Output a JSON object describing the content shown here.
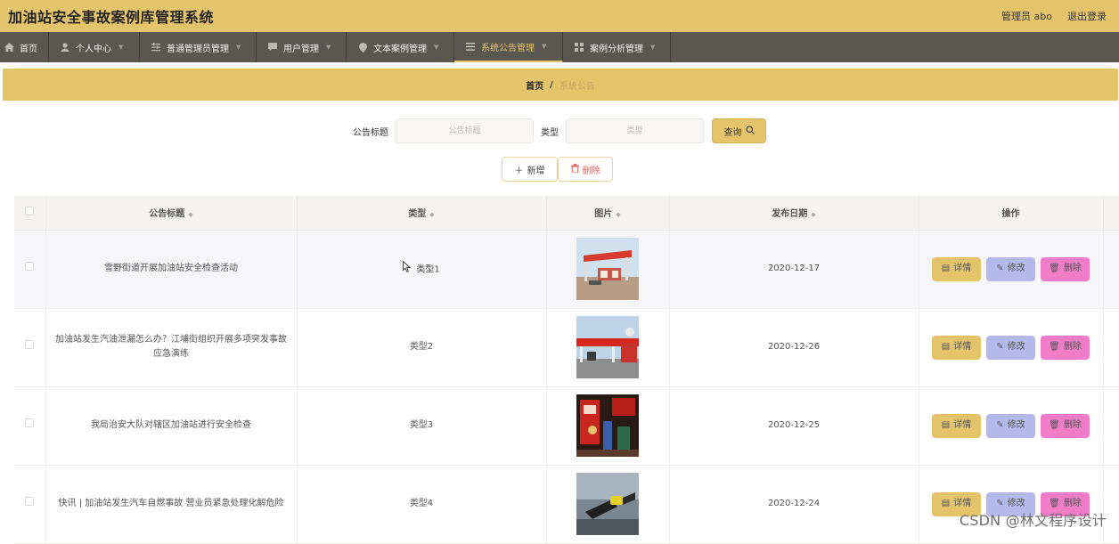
{
  "header": {
    "title": "加油站安全事故案例库管理系统",
    "user": "管理员 abo",
    "logout": "退出登录"
  },
  "nav": [
    {
      "label": "首页",
      "icon": "home-icon"
    },
    {
      "label": "个人中心",
      "icon": "person-icon"
    },
    {
      "label": "普通管理员管理",
      "icon": "sliders-icon"
    },
    {
      "label": "用户管理",
      "icon": "chat-icon"
    },
    {
      "label": "文本案例管理",
      "icon": "pin-icon"
    },
    {
      "label": "系统公告管理",
      "icon": "list-icon"
    },
    {
      "label": "案例分析管理",
      "icon": "grid-icon"
    }
  ],
  "breadcrumb": {
    "home": "首页",
    "sep": "/",
    "current": "系统公告"
  },
  "search": {
    "title_label": "公告标题",
    "title_placeholder": "公告标题",
    "type_label": "类型",
    "type_placeholder": "类型",
    "query_label": "查询"
  },
  "actions": {
    "add_label": "新增",
    "delete_label": "删除"
  },
  "table": {
    "headers": {
      "title": "公告标题",
      "type": "类型",
      "image": "图片",
      "date": "发布日期",
      "ops": "操作"
    },
    "rows": [
      {
        "title": "雪野街道开展加油站安全检查活动",
        "type": "类型1",
        "date": "2020-12-17"
      },
      {
        "title": "加油站发生汽油泄漏怎么办？江埔街组织开展多项突发事故应急演练",
        "type": "类型2",
        "date": "2020-12-26"
      },
      {
        "title": "我局治安大队对辖区加油站进行安全检查",
        "type": "类型3",
        "date": "2020-12-25"
      },
      {
        "title": "快讯 | 加油站发生汽车自燃事故 营业员紧急处理化解危险",
        "type": "类型4",
        "date": "2020-12-24"
      }
    ],
    "op_labels": {
      "detail": "详情",
      "edit": "修改",
      "delete": "删除"
    }
  },
  "watermark": "CSDN @林文程序设计",
  "colors": {
    "accent": "#e4c46b",
    "nav_bg": "#5a5651",
    "edit": "#b4b8ea",
    "delete": "#f07cc8"
  }
}
